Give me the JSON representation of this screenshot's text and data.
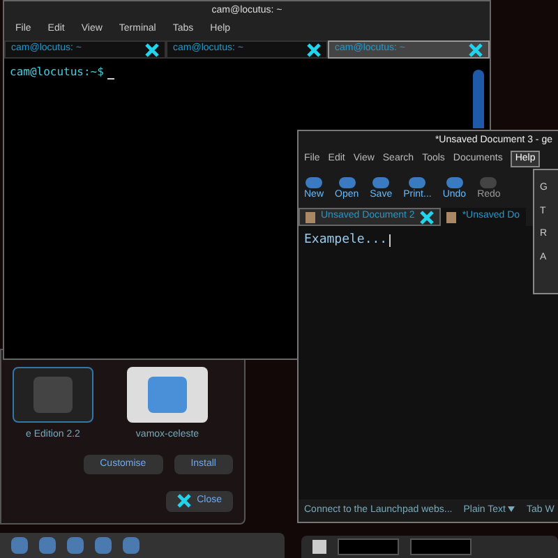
{
  "terminal": {
    "title": "cam@locutus: ~",
    "menu": [
      "File",
      "Edit",
      "View",
      "Terminal",
      "Tabs",
      "Help"
    ],
    "tabs": [
      {
        "label": "cam@locutus: ~",
        "selected": false
      },
      {
        "label": "cam@locutus: ~",
        "selected": false
      },
      {
        "label": "cam@locutus: ~",
        "selected": true
      }
    ],
    "prompt": "cam@locutus:~$"
  },
  "theme_manager": {
    "themes": [
      {
        "name": "e Edition 2.2",
        "selected": false
      },
      {
        "name": "vamox-celeste",
        "selected": true
      }
    ],
    "buttons": [
      "Customise",
      "Install"
    ],
    "close": "Close"
  },
  "editor": {
    "title": "*Unsaved Document 3 - ge",
    "menu": [
      {
        "label": "File",
        "selected": false
      },
      {
        "label": "Edit",
        "selected": false
      },
      {
        "label": "View",
        "selected": false
      },
      {
        "label": "Search",
        "selected": false
      },
      {
        "label": "Tools",
        "selected": false
      },
      {
        "label": "Documents",
        "selected": false
      },
      {
        "label": "Help",
        "selected": true
      }
    ],
    "toolbar": [
      {
        "label": "New",
        "disabled": false
      },
      {
        "label": "Open",
        "disabled": false
      },
      {
        "label": "Save",
        "disabled": false
      },
      {
        "label": "Print...",
        "disabled": false
      },
      {
        "label": "Undo",
        "disabled": false
      },
      {
        "label": "Redo",
        "disabled": true
      }
    ],
    "tabs": [
      {
        "label": "Unsaved Document 2",
        "selected": true
      },
      {
        "label": "*Unsaved Do",
        "selected": false
      }
    ],
    "text": "Exampele...",
    "help_menu": [
      "G",
      "T",
      "R",
      "A"
    ],
    "status_bar": [
      "Connect to the Launchpad webs...",
      "Plain Text",
      "Tab W"
    ]
  }
}
